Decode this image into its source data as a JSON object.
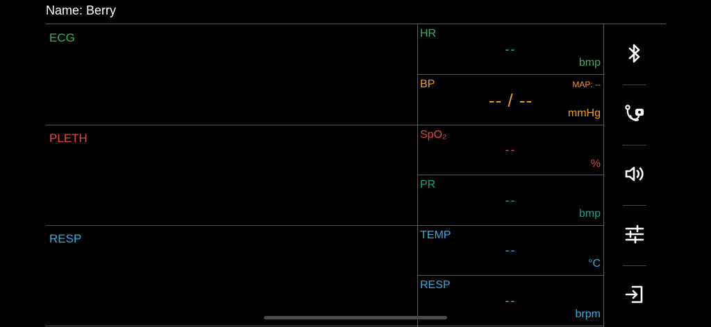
{
  "header": {
    "name_text": "Name: Berry"
  },
  "waveforms": {
    "ecg": {
      "label": "ECG",
      "color": "#3fae5f"
    },
    "pleth": {
      "label": "PLETH",
      "color": "#e8473f"
    },
    "resp": {
      "label": "RESP",
      "color": "#2faee0"
    }
  },
  "params": {
    "hr": {
      "label": "HR",
      "value": "--",
      "unit": "bmp",
      "color": "#3fae5f"
    },
    "bp": {
      "label": "BP",
      "value": "-- / --",
      "map": "MAP: --",
      "unit": "mmHg",
      "color": "#f39c1f"
    },
    "spo2": {
      "label": "SpO₂",
      "value": "--",
      "unit": "%",
      "color": "#e8473f"
    },
    "pr": {
      "label": "PR",
      "value": "--",
      "unit": "bmp",
      "color": "#1aa38c"
    },
    "temp": {
      "label": "TEMP",
      "value": "--",
      "unit": "°C",
      "color": "#2faee0"
    },
    "resp": {
      "label": "RESP",
      "value": "--",
      "unit": "brpm",
      "color": "#2faee0"
    }
  },
  "sidebar": {
    "buttons": [
      {
        "icon": "bluetooth-icon"
      },
      {
        "icon": "stethoscope-icon"
      },
      {
        "icon": "volume-icon"
      },
      {
        "icon": "sliders-icon"
      },
      {
        "icon": "exit-icon"
      }
    ]
  }
}
